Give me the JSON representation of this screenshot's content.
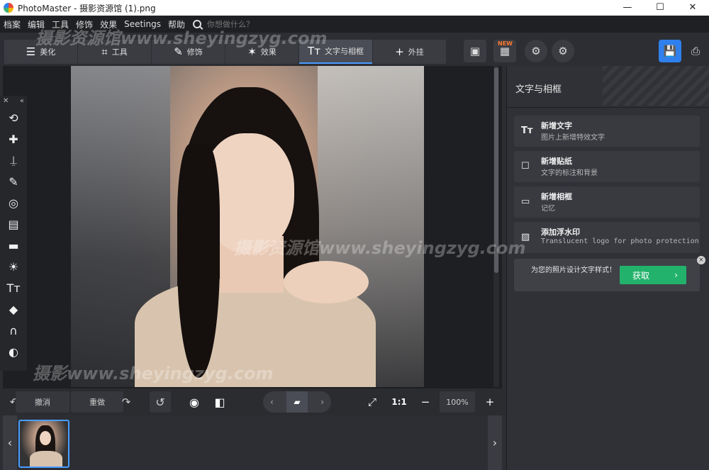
{
  "window": {
    "title": "PhotoMaster - 摄影资源馆 (1).png",
    "min_glyph": "—",
    "max_glyph": "☐",
    "close_glyph": "✕"
  },
  "menu": {
    "items": [
      "档案",
      "编辑",
      "工具",
      "修饰",
      "效果",
      "Seetings",
      "帮助"
    ],
    "search_placeholder": "你想做什么？"
  },
  "tabs": [
    {
      "label": "美化",
      "icon": "sliders-icon",
      "glyph": "☰"
    },
    {
      "label": "工具",
      "icon": "crop-icon",
      "glyph": "⌗"
    },
    {
      "label": "修饰",
      "icon": "brush-icon",
      "glyph": "✎"
    },
    {
      "label": "效果",
      "icon": "magic-wand-icon",
      "glyph": "✶"
    },
    {
      "label": "文字与相框",
      "icon": "text-icon",
      "glyph": "Tт"
    },
    {
      "label": "外挂",
      "icon": "plus-icon",
      "glyph": "+"
    }
  ],
  "active_tab": 4,
  "toolbar": {
    "new_badge": "NEW",
    "gallery_glyph": "▣",
    "collage_glyph": "▦",
    "adjust_add_glyph": "⚙",
    "adjust_dl_glyph": "⚙",
    "save_glyph": "💾",
    "print_glyph": "⎙"
  },
  "palette": {
    "close_glyph": "✕",
    "collapse_glyph": "«",
    "tools": [
      {
        "icon": "rotate-crop-icon",
        "glyph": "⟲"
      },
      {
        "icon": "healing-bandage-icon",
        "glyph": "✚"
      },
      {
        "icon": "stamp-icon",
        "glyph": "⍊"
      },
      {
        "icon": "brush-icon",
        "glyph": "✎"
      },
      {
        "icon": "radial-selection-icon",
        "glyph": "◎"
      },
      {
        "icon": "gradient-filter-icon",
        "glyph": "▤"
      },
      {
        "icon": "vignette-icon",
        "glyph": "▬"
      },
      {
        "icon": "light-icon",
        "glyph": "☀"
      },
      {
        "icon": "text-tool-icon",
        "glyph": "Tт"
      },
      {
        "icon": "paint-bucket-icon",
        "glyph": "◆"
      },
      {
        "icon": "magnet-icon",
        "glyph": "∩"
      },
      {
        "icon": "mask-icon",
        "glyph": "◐"
      }
    ]
  },
  "bottom": {
    "undo_label": "撤消",
    "redo_label": "重做",
    "undo_glyph": "↶",
    "redo_glyph": "↷",
    "rotate_glyph": "↺",
    "eye_glyph": "◉",
    "compare_glyph": "◧",
    "prev_glyph": "‹",
    "next_glyph": "›",
    "folder_glyph": "▰",
    "fit_glyph": "⤢",
    "one_to_one": "1:1",
    "zoom_out_glyph": "−",
    "zoom_value": "100%",
    "zoom_in_glyph": "+"
  },
  "filmstrip": {
    "left_glyph": "‹",
    "right_glyph": "›"
  },
  "right_panel": {
    "title": "文字与相框",
    "cards": [
      {
        "icon": "text-add-icon",
        "glyph": "Tт",
        "title": "新增文字",
        "subtitle": "图片上新增特效文字"
      },
      {
        "icon": "sticker-icon",
        "glyph": "☐",
        "title": "新增贴纸",
        "subtitle": "文字的标注和背景"
      },
      {
        "icon": "frame-icon",
        "glyph": "▭",
        "title": "新增相框",
        "subtitle": "记忆"
      },
      {
        "icon": "watermark-icon",
        "glyph": "▨",
        "title": "添加浮水印",
        "subtitle": "Translucent logo for photo protection"
      }
    ],
    "promo": {
      "text": "为您的照片设计文字样式！",
      "button_label": "获取",
      "button_glyph": "›",
      "close_glyph": "×"
    }
  },
  "watermarks": [
    "摄影资源馆www.sheyingzyg.com",
    "摄影资源馆www.sheyingzyg.com",
    "摄影www.sheyingzyg.com"
  ],
  "colors": {
    "accent": "#4a9eff",
    "save_button": "#2f80ed",
    "get_button": "#23b26b",
    "new_badge": "#ff7a30"
  }
}
